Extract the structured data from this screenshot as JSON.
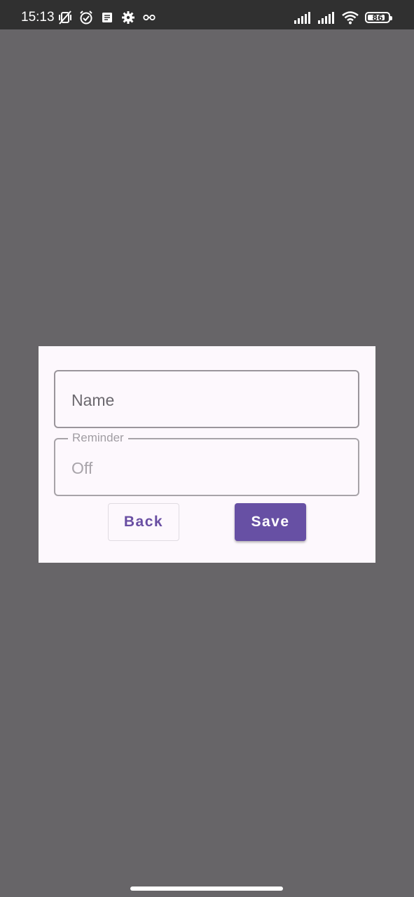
{
  "status_bar": {
    "time": "15:13",
    "battery_level": "86",
    "battery_percent": 86,
    "left_icons": [
      "vibrate-muted-icon",
      "alarm-icon",
      "notes-icon",
      "settings-gear-icon",
      "infinity-icon"
    ],
    "right_icons": [
      "signal-icon",
      "signal-icon",
      "wifi-icon",
      "battery-icon"
    ]
  },
  "dialog": {
    "name_field": {
      "placeholder": "Name",
      "value": ""
    },
    "reminder_field": {
      "label": "Reminder",
      "value": "Off"
    },
    "buttons": {
      "back_label": "Back",
      "save_label": "Save"
    }
  },
  "colors": {
    "scrim": "#676568",
    "status_bar": "#303030",
    "dialog_background": "#fdf8fd",
    "accent": "#6750a4"
  }
}
